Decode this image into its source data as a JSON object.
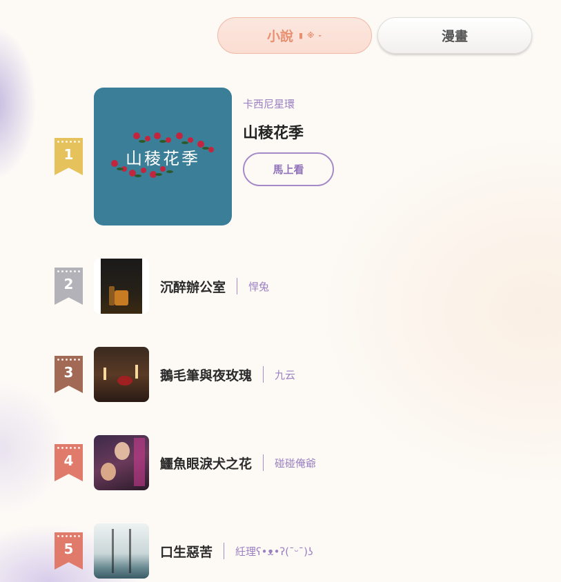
{
  "tabs": [
    {
      "label": "小說",
      "deco": "▮ ※ -",
      "active": true
    },
    {
      "label": "漫畫",
      "active": false
    }
  ],
  "featured": {
    "rank": "1",
    "cover_text": "山稜花季",
    "author": "卡西尼星環",
    "title": "山稜花季",
    "button_label": "馬上看"
  },
  "ranking": [
    {
      "rank": "2",
      "title": "沉醉辦公室",
      "author": "悍兔"
    },
    {
      "rank": "3",
      "title": "鵝毛筆與夜玫瑰",
      "author": "九云"
    },
    {
      "rank": "4",
      "title": "鱷魚眼淚犬之花",
      "author": "碰碰俺爺"
    },
    {
      "rank": "5",
      "title": "口生惡苦",
      "author": "紝理ʕ•ᴥ•ʔ(¯ᵕ¯)ʖ"
    }
  ],
  "colors": {
    "accent_purple": "#9a7fc0",
    "tab_active": "#e88f70",
    "rank_gold": "#e6c25d",
    "rank_silver": "#b3b2b8",
    "rank_bronze": "#a26a55",
    "rank_red": "#e07a6a"
  }
}
